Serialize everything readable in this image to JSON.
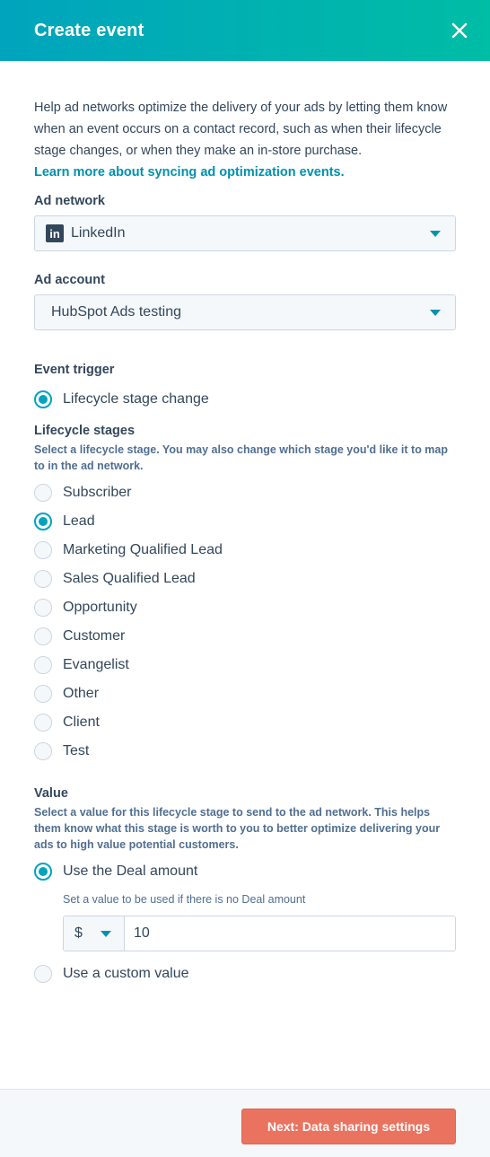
{
  "header": {
    "title": "Create event",
    "close_icon": "close-icon"
  },
  "intro": {
    "text": "Help ad networks optimize the delivery of your ads by letting them know when an event occurs on a contact record, such as when their lifecycle stage changes, or when they make an in-store purchase.",
    "link": "Learn more about syncing ad optimization events."
  },
  "ad_network": {
    "label": "Ad network",
    "value": "LinkedIn",
    "icon": "linkedin-icon"
  },
  "ad_account": {
    "label": "Ad account",
    "value": "HubSpot Ads testing"
  },
  "event_trigger": {
    "label": "Event trigger",
    "option": "Lifecycle stage change",
    "selected": true
  },
  "lifecycle": {
    "label": "Lifecycle stages",
    "help": "Select a lifecycle stage. You may also change which stage you'd like it to map to in the ad network.",
    "options": [
      "Subscriber",
      "Lead",
      "Marketing Qualified Lead",
      "Sales Qualified Lead",
      "Opportunity",
      "Customer",
      "Evangelist",
      "Other",
      "Client",
      "Test"
    ],
    "selected": "Lead"
  },
  "value": {
    "label": "Value",
    "help": "Select a value for this lifecycle stage to send to the ad network. This helps them know what this stage is worth to you to better optimize delivering your ads to high value potential customers.",
    "options": [
      "Use the Deal amount",
      "Use a custom value"
    ],
    "selected": "Use the Deal amount",
    "hint": "Set a value to be used if there is no Deal amount",
    "currency": "$",
    "amount": "10"
  },
  "footer": {
    "next_label": "Next: Data sharing settings"
  },
  "colors": {
    "accent": "#00a4bd",
    "link": "#0091ae",
    "primary_button": "#ea7360",
    "text": "#33475b"
  }
}
